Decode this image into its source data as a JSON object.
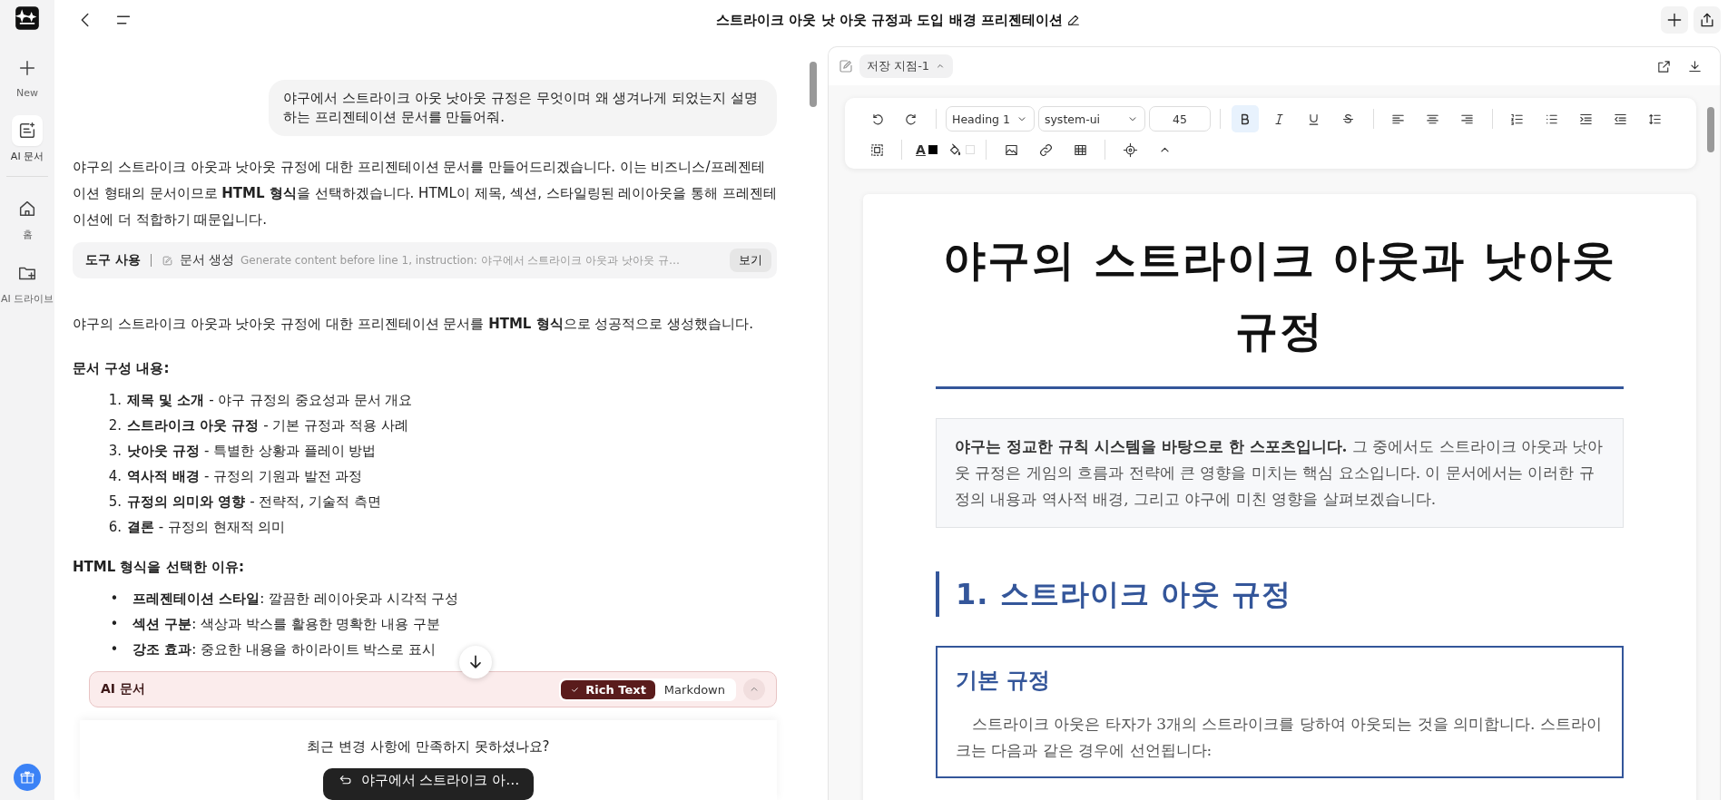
{
  "sidebar": {
    "items": [
      {
        "label": "New",
        "kind": "plus",
        "selected": false
      },
      {
        "label": "AI 문서",
        "kind": "doc",
        "selected": true
      },
      {
        "label": "홈",
        "kind": "home",
        "selected": false
      },
      {
        "label": "AI 드라이브",
        "kind": "folder",
        "selected": false
      }
    ]
  },
  "header": {
    "title": "스트라이크 아웃 낫 아웃 규정과 도입 배경 프리젠테이션"
  },
  "chat": {
    "user_message": "야구에서 스트라이크 아웃 낫아웃 규정은 무엇이며 왜 생겨나게 되었는지 설명하는 프리젠테이션 문서를 만들어줘.",
    "intro": "야구의 스트라이크 아웃과 낫아웃 규정에 대한 프리젠테이션 문서를 만들어드리겠습니다. 이는 비즈니스/프레젠테이션 형태의 문서이므로 **HTML 형식**을 선택하겠습니다. HTML이 제목, 섹션, 스타일링된 레이아웃을 통해 프레젠테이션에 더 적합하기 때문입니다.",
    "tool_use": {
      "label": "도구 사용",
      "action": "문서 생성",
      "detail": "Generate content before line 1, instruction: 야구에서 스트라이크 아웃과 낫아웃 규…",
      "button": "보기"
    },
    "result": "야구의 스트라이크 아웃과 낫아웃 규정에 대한 프리젠테이션 문서를 **HTML 형식**으로 성공적으로 생성했습니다.",
    "contents_heading": "문서 구성 내용:",
    "contents": [
      {
        "marker": "1.",
        "text": "**제목 및 소개** - 야구 규정의 중요성과 문서 개요"
      },
      {
        "marker": "2.",
        "text": "**스트라이크 아웃 규정** - 기본 규정과 적용 사례"
      },
      {
        "marker": "3.",
        "text": "**낫아웃 규정** - 특별한 상황과 플레이 방법"
      },
      {
        "marker": "4.",
        "text": "**역사적 배경** - 규정의 기원과 발전 과정"
      },
      {
        "marker": "5.",
        "text": "**규정의 의미와 영향** - 전략적, 기술적 측면"
      },
      {
        "marker": "6.",
        "text": "**결론** - 규정의 현재적 의미"
      }
    ],
    "reasons_heading": "HTML 형식을 선택한 이유:",
    "reasons": [
      {
        "marker": "•",
        "text": "**프레젠테이션 스타일**: 깔끔한 레이아웃과 시각적 구성"
      },
      {
        "marker": "•",
        "text": "**섹션 구분**: 색상과 박스를 활용한 명확한 내용 구분"
      },
      {
        "marker": "•",
        "text": "**강조 효과**: 중요한 내용을 하이라이트 박스로 표시"
      }
    ],
    "doc_bar": {
      "title": "AI 문서",
      "modes": [
        {
          "label": "Rich Text",
          "selected": true
        },
        {
          "label": "Markdown",
          "selected": false
        }
      ]
    },
    "feedback": {
      "question": "최근 변경 사항에 만족하지 못하셨나요?",
      "button": "야구에서 스트라이크 아…"
    }
  },
  "editor": {
    "checkpoint": "저장 지점-1",
    "style_select": "Heading 1",
    "font_select": "system-ui",
    "font_size": "45",
    "toolbar": [
      [
        {
          "kind": "undo",
          "active": false
        },
        {
          "kind": "redo",
          "active": false
        }
      ],
      [
        {
          "kind": "bold",
          "active": true
        },
        {
          "kind": "italic",
          "active": false
        },
        {
          "kind": "underline",
          "active": false
        },
        {
          "kind": "strike",
          "active": false
        }
      ],
      [
        {
          "kind": "align-left",
          "active": false
        },
        {
          "kind": "align-center",
          "active": false
        },
        {
          "kind": "align-right",
          "active": false
        }
      ],
      [
        {
          "kind": "ordered-list",
          "active": false
        },
        {
          "kind": "bullet-list",
          "active": false
        },
        {
          "kind": "indent",
          "active": false
        },
        {
          "kind": "outdent",
          "active": false
        },
        {
          "kind": "line-height",
          "active": false
        }
      ],
      [
        {
          "kind": "select-all",
          "active": false
        }
      ],
      [
        {
          "kind": "text-color",
          "label": "A",
          "color": "#000000",
          "active": false
        },
        {
          "kind": "fill-color",
          "color": "#ffffff",
          "active": false
        }
      ],
      [
        {
          "kind": "image",
          "active": false
        },
        {
          "kind": "link",
          "active": false
        },
        {
          "kind": "table",
          "active": false
        }
      ],
      [
        {
          "kind": "target",
          "active": false
        },
        {
          "kind": "collapse",
          "active": false
        }
      ]
    ],
    "document": {
      "title": "야구의 스트라이크 아웃과 낫아웃 규정",
      "intro": "**야구는 정교한 규칙 시스템을 바탕으로 한 스포츠입니다.** 그 중에서도 스트라이크 아웃과 낫아웃 규정은 게임의 흐름과 전략에 큰 영향을 미치는 핵심 요소입니다. 이 문서에서는 이러한 규정의 내용과 역사적 배경, 그리고 야구에 미친 영향을 살펴보겠습니다.",
      "section_heading": "1. 스트라이크 아웃 규정",
      "box_heading": "기본 규정",
      "box_text": "스트라이크 아웃은 타자가 3개의 스트라이크를 당하여 아웃되는 것을 의미합니다. 스트라이크는 다음과 같은 경우에 선언됩니다:"
    }
  }
}
